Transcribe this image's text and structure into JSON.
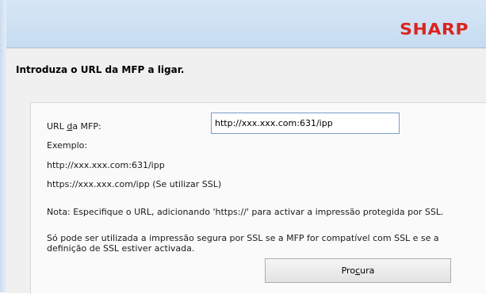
{
  "brand": {
    "logo": "SHARP",
    "color": "#d9241f"
  },
  "instruction": "Introduza o URL da MFP a ligar.",
  "form": {
    "url_label_pre": "URL ",
    "url_label_key": "d",
    "url_label_post": "a MFP:",
    "url_value": "http://xxx.xxx.com:631/ipp",
    "example_title": "Exemplo:",
    "example_1": "http://xxx.xxx.com:631/ipp",
    "example_2": "https://xxx.xxx.com/ipp (Se utilizar SSL)",
    "note": "Nota: Especifique o URL, adicionando 'https://' para activar a impressão protegida por SSL.",
    "ssl_text": "Só pode ser utilizada a impressão segura por SSL se a MFP for compatível com SSL e se a definição de SSL estiver activada.",
    "browse_pre": "Pro",
    "browse_key": "c",
    "browse_post": "ura"
  }
}
